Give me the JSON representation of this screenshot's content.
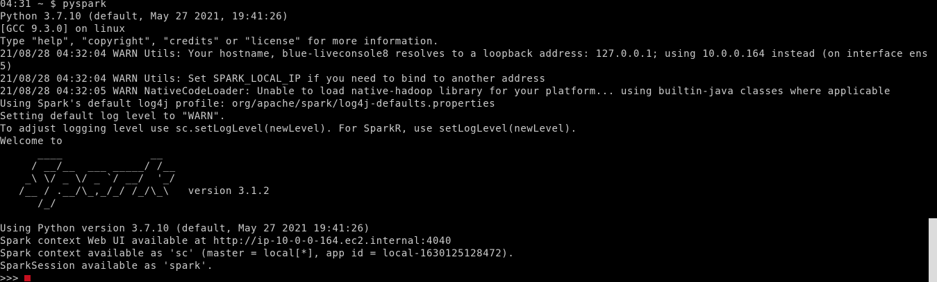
{
  "theme": {
    "background": "#000000",
    "foreground": "#cccccc",
    "cursor_color": "#c50f1f",
    "scrollbar_thumb": "#dcdcdc"
  },
  "terminal": {
    "lines": [
      "04:31 ~ $ pyspark",
      "Python 3.7.10 (default, May 27 2021, 19:41:26)",
      "[GCC 9.3.0] on linux",
      "Type \"help\", \"copyright\", \"credits\" or \"license\" for more information.",
      "21/08/28 04:32:04 WARN Utils: Your hostname, blue-liveconsole8 resolves to a loopback address: 127.0.0.1; using 10.0.0.164 instead (on interface ens",
      "5)",
      "21/08/28 04:32:04 WARN Utils: Set SPARK_LOCAL_IP if you need to bind to another address",
      "21/08/28 04:32:05 WARN NativeCodeLoader: Unable to load native-hadoop library for your platform... using builtin-java classes where applicable",
      "Using Spark's default log4j profile: org/apache/spark/log4j-defaults.properties",
      "Setting default log level to \"WARN\".",
      "To adjust logging level use sc.setLogLevel(newLevel). For SparkR, use setLogLevel(newLevel).",
      "Welcome to",
      "      ____              __",
      "     / __/__  ___ _____/ /__",
      "    _\\ \\/ _ \\/ _ `/ __/  '_/",
      "   /__ / .__/\\_,_/_/ /_/\\_\\   version 3.1.2",
      "      /_/",
      "",
      "Using Python version 3.7.10 (default, May 27 2021 19:41:26)",
      "Spark context Web UI available at http://ip-10-0-0-164.ec2.internal:4040",
      "Spark context available as 'sc' (master = local[*], app id = local-1630125128472).",
      "SparkSession available as 'spark'.",
      ">>> "
    ]
  }
}
